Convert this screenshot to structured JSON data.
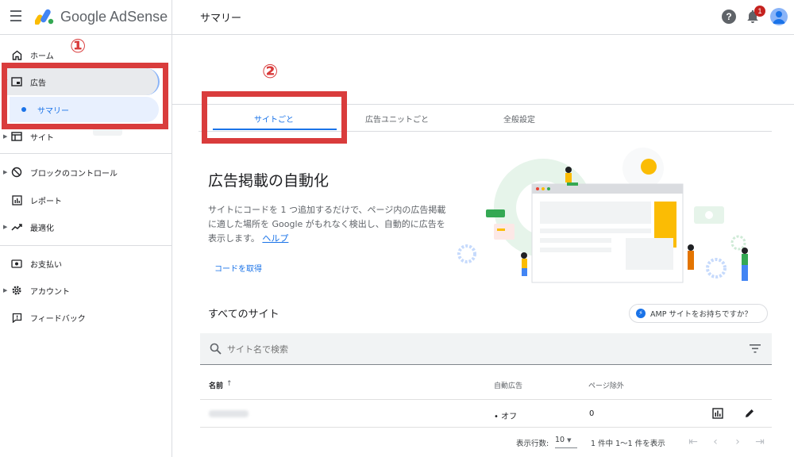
{
  "app": {
    "brand": "Google AdSense",
    "page_title": "サマリー"
  },
  "header": {
    "notification_count": "1",
    "help_glyph": "?"
  },
  "sidebar": {
    "items": [
      {
        "label": "ホーム"
      },
      {
        "label": "広告"
      },
      {
        "label": "サマリー"
      },
      {
        "label": "サイト"
      },
      {
        "label": "ブロックのコントロール"
      },
      {
        "label": "レポート"
      },
      {
        "label": "最適化"
      },
      {
        "label": "お支払い"
      },
      {
        "label": "アカウント"
      },
      {
        "label": "フィードバック"
      }
    ]
  },
  "annotations": {
    "one": "①",
    "two": "②"
  },
  "tabs": [
    {
      "label": "サイトごと",
      "active": true
    },
    {
      "label": "広告ユニットごと",
      "active": false
    },
    {
      "label": "全般設定",
      "active": false
    }
  ],
  "hero": {
    "title": "広告掲載の自動化",
    "description": "サイトにコードを 1 つ追加するだけで、ページ内の広告掲載に適した場所を Google がもれなく検出し、自動的に広告を表示します。",
    "help_link": "ヘルプ",
    "get_code": "コードを取得"
  },
  "sites": {
    "title": "すべてのサイト",
    "amp_chip": "AMP サイトをお持ちですか？",
    "search_placeholder": "サイト名で検索",
    "columns": {
      "name": "名前",
      "sort_arrow": "↑",
      "auto_ads": "自動広告",
      "page_exclusions": "ページ除外"
    },
    "rows": [
      {
        "auto_ads": "オフ",
        "page_exclusions": "0"
      }
    ],
    "pager": {
      "rows_label": "表示行数:",
      "rows_value": "10",
      "range": "1 件中 1〜1 件を表示"
    }
  },
  "colors": {
    "accent": "#1a73e8",
    "annotation": "#d93c3c",
    "badge": "#c5221f"
  }
}
